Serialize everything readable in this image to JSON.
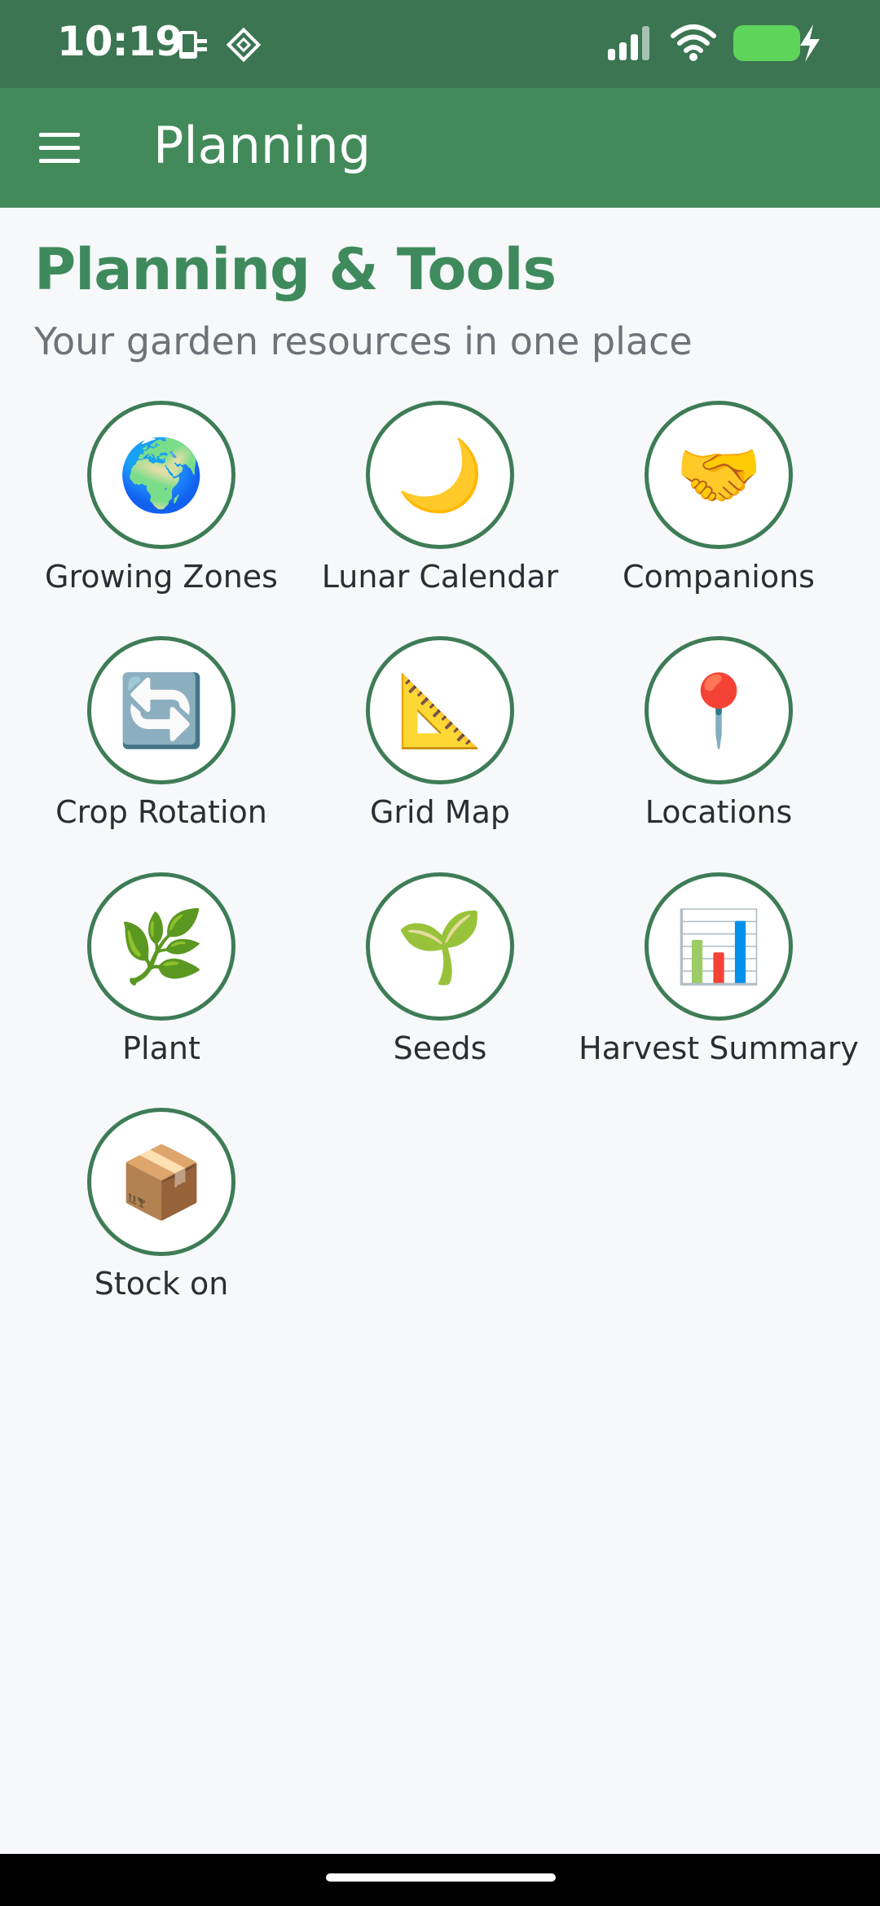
{
  "status_bar": {
    "time": "10:19",
    "icons": [
      "phone-sync-icon",
      "diamond-app-icon",
      "cellular-signal-icon",
      "wifi-icon",
      "battery-charging-icon"
    ],
    "battery_color": "#5fd45a"
  },
  "app_bar": {
    "title": "Planning",
    "menu_icon": "hamburger-menu-icon"
  },
  "page": {
    "heading": "Planning & Tools",
    "subheading": "Your garden resources in one place"
  },
  "tools": [
    {
      "id": "growing-zones",
      "label": "Growing Zones",
      "icon": "🌍"
    },
    {
      "id": "lunar-calendar",
      "label": "Lunar Calendar",
      "icon": "🌙"
    },
    {
      "id": "companions",
      "label": "Companions",
      "icon": "🤝"
    },
    {
      "id": "crop-rotation",
      "label": "Crop Rotation",
      "icon": "🔄"
    },
    {
      "id": "grid-map",
      "label": "Grid Map",
      "icon": "📐"
    },
    {
      "id": "locations",
      "label": "Locations",
      "icon": "📍"
    },
    {
      "id": "plant",
      "label": "Plant",
      "icon": "🌿"
    },
    {
      "id": "seeds",
      "label": "Seeds",
      "icon": "🌱"
    },
    {
      "id": "harvest-summary",
      "label": "Harvest Summary",
      "icon": "📊"
    },
    {
      "id": "stock-on",
      "label": "Stock on",
      "icon": "📦"
    }
  ],
  "colors": {
    "status_bar": "#3b7552",
    "app_bar": "#438a5b",
    "heading": "#3f8a5c",
    "circle_border": "#3e7c56",
    "background": "#f6f8fa"
  }
}
